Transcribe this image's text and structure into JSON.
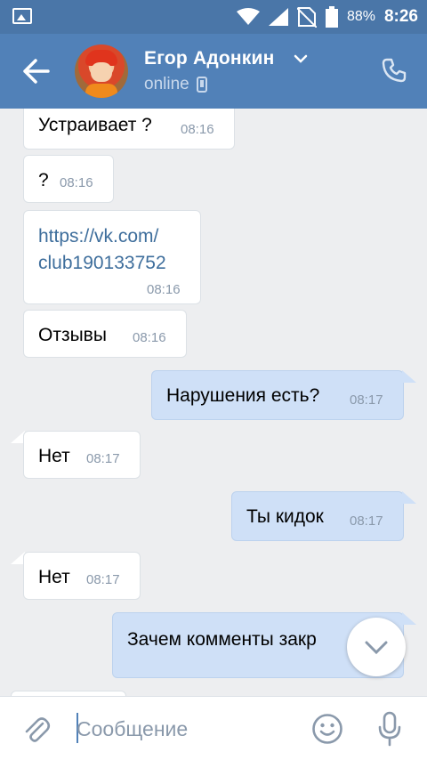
{
  "status_bar": {
    "battery": "88%",
    "time": "8:26"
  },
  "header": {
    "contact_name": "Егор Адонкин",
    "status": "online",
    "icons": {
      "back": "arrow-left-icon",
      "dropdown": "chevron-down-icon",
      "device": "mobile-phone-icon",
      "call": "phone-icon"
    }
  },
  "messages": [
    {
      "direction": "in",
      "text": "Устраивает ?",
      "time": "08:16"
    },
    {
      "direction": "in",
      "text": "?",
      "time": "08:16"
    },
    {
      "direction": "in",
      "text": "https://vk.com/club190133752",
      "text_line1": "https://vk.com/",
      "text_line2": "club190133752",
      "time": "08:16",
      "is_link": true
    },
    {
      "direction": "in",
      "text": "Отзывы",
      "time": "08:16"
    },
    {
      "direction": "out",
      "text": "Нарушения есть?",
      "time": "08:17"
    },
    {
      "direction": "in",
      "text": "Нет",
      "time": "08:17"
    },
    {
      "direction": "out",
      "text": "Ты кидок",
      "time": "08:17"
    },
    {
      "direction": "in",
      "text": "Нет",
      "time": "08:17"
    },
    {
      "direction": "out",
      "text": "Зачем комменты закр",
      "time": ""
    }
  ],
  "composer": {
    "placeholder": "Сообщение",
    "value": "",
    "icons": {
      "attach": "paperclip-icon",
      "emoji": "smiley-icon",
      "voice": "microphone-icon",
      "scroll": "chevron-down-icon"
    }
  },
  "colors": {
    "header": "#5181b8",
    "status_bar": "#4a76a8",
    "background": "#edeef0",
    "incoming_bubble": "#ffffff",
    "outgoing_bubble": "#cfe0f7",
    "link": "#3e6e9c"
  }
}
